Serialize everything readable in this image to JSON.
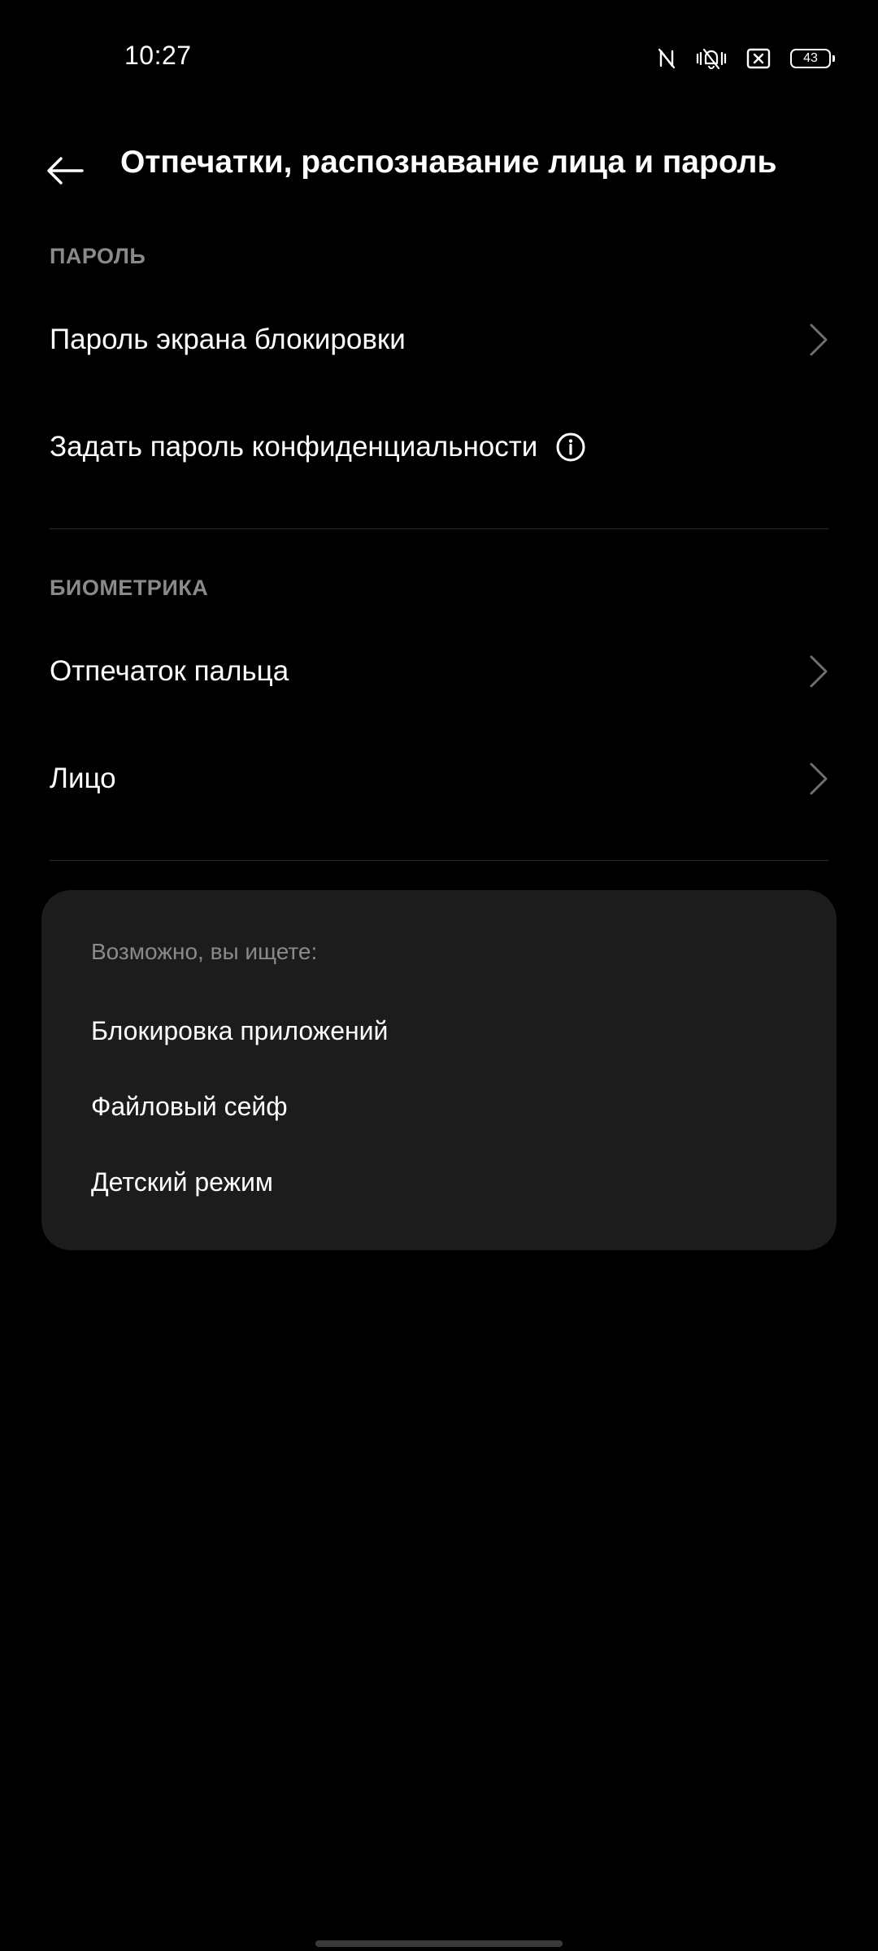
{
  "status_bar": {
    "time": "10:27",
    "icons": [
      "nfc-icon",
      "vibrate-mute-icon",
      "close-box-icon",
      "battery-icon"
    ],
    "battery_level": "43"
  },
  "header": {
    "back_icon": "arrow-left-icon",
    "title": "Отпечатки, распознавание лица и пароль"
  },
  "sections": {
    "password": {
      "header": "ПАРОЛЬ",
      "items": [
        {
          "label": "Пароль экрана блокировки",
          "trailing": "chevron-right-icon"
        },
        {
          "label": "Задать пароль конфиденциальности",
          "trailing": "info-icon"
        }
      ]
    },
    "biometrics": {
      "header": "БИОМЕТРИКА",
      "items": [
        {
          "label": "Отпечаток пальца",
          "trailing": "chevron-right-icon"
        },
        {
          "label": "Лицо",
          "trailing": "chevron-right-icon"
        }
      ]
    }
  },
  "suggestions": {
    "title": "Возможно, вы ищете:",
    "items": [
      "Блокировка приложений",
      "Файловый сейф",
      "Детский режим"
    ]
  },
  "colors": {
    "background": "#000000",
    "card": "#1c1c1c",
    "text_primary": "#ffffff",
    "text_secondary": "#8a8a8a",
    "divider": "#2a2a2a"
  }
}
